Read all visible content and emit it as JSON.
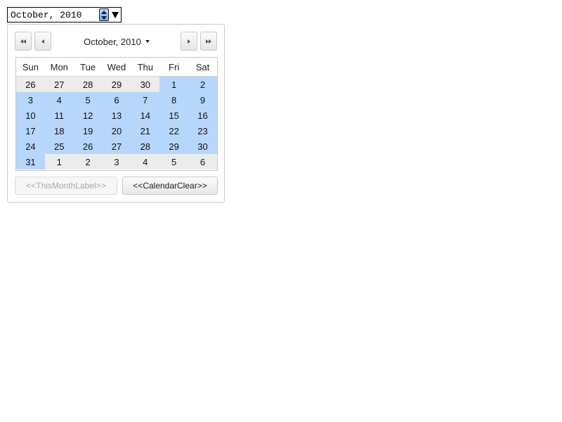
{
  "month_input": {
    "value": "October, 2010"
  },
  "calendar": {
    "header_label": "October, 2010",
    "weekdays": [
      "Sun",
      "Mon",
      "Tue",
      "Wed",
      "Thu",
      "Fri",
      "Sat"
    ],
    "weeks": [
      [
        {
          "d": "26",
          "m": "other"
        },
        {
          "d": "27",
          "m": "other"
        },
        {
          "d": "28",
          "m": "other"
        },
        {
          "d": "29",
          "m": "other"
        },
        {
          "d": "30",
          "m": "other"
        },
        {
          "d": "1",
          "m": "cur"
        },
        {
          "d": "2",
          "m": "cur"
        }
      ],
      [
        {
          "d": "3",
          "m": "cur"
        },
        {
          "d": "4",
          "m": "cur"
        },
        {
          "d": "5",
          "m": "cur"
        },
        {
          "d": "6",
          "m": "cur"
        },
        {
          "d": "7",
          "m": "cur"
        },
        {
          "d": "8",
          "m": "cur"
        },
        {
          "d": "9",
          "m": "cur"
        }
      ],
      [
        {
          "d": "10",
          "m": "cur"
        },
        {
          "d": "11",
          "m": "cur"
        },
        {
          "d": "12",
          "m": "cur"
        },
        {
          "d": "13",
          "m": "cur"
        },
        {
          "d": "14",
          "m": "cur"
        },
        {
          "d": "15",
          "m": "cur"
        },
        {
          "d": "16",
          "m": "cur"
        }
      ],
      [
        {
          "d": "17",
          "m": "cur"
        },
        {
          "d": "18",
          "m": "cur"
        },
        {
          "d": "19",
          "m": "cur"
        },
        {
          "d": "20",
          "m": "cur"
        },
        {
          "d": "21",
          "m": "cur"
        },
        {
          "d": "22",
          "m": "cur"
        },
        {
          "d": "23",
          "m": "cur"
        }
      ],
      [
        {
          "d": "24",
          "m": "cur"
        },
        {
          "d": "25",
          "m": "cur"
        },
        {
          "d": "26",
          "m": "cur"
        },
        {
          "d": "27",
          "m": "cur"
        },
        {
          "d": "28",
          "m": "cur"
        },
        {
          "d": "29",
          "m": "cur"
        },
        {
          "d": "30",
          "m": "cur"
        }
      ],
      [
        {
          "d": "31",
          "m": "cur"
        },
        {
          "d": "1",
          "m": "other"
        },
        {
          "d": "2",
          "m": "other"
        },
        {
          "d": "3",
          "m": "other"
        },
        {
          "d": "4",
          "m": "other"
        },
        {
          "d": "5",
          "m": "other"
        },
        {
          "d": "6",
          "m": "other"
        }
      ]
    ],
    "this_month_label": "<<ThisMonthLabel>>",
    "clear_label": "<<CalendarClear>>"
  },
  "colors": {
    "current_month_cell": "#b7d6fb",
    "other_month_cell": "#ececec"
  },
  "icons": {
    "spinner": "spinner-icon",
    "dropdown": "dropdown-arrow-icon",
    "prev_year": "double-chevron-left-icon",
    "prev_month": "chevron-left-icon",
    "next_month": "chevron-right-icon",
    "next_year": "double-chevron-right-icon",
    "month_caret": "caret-down-icon"
  }
}
